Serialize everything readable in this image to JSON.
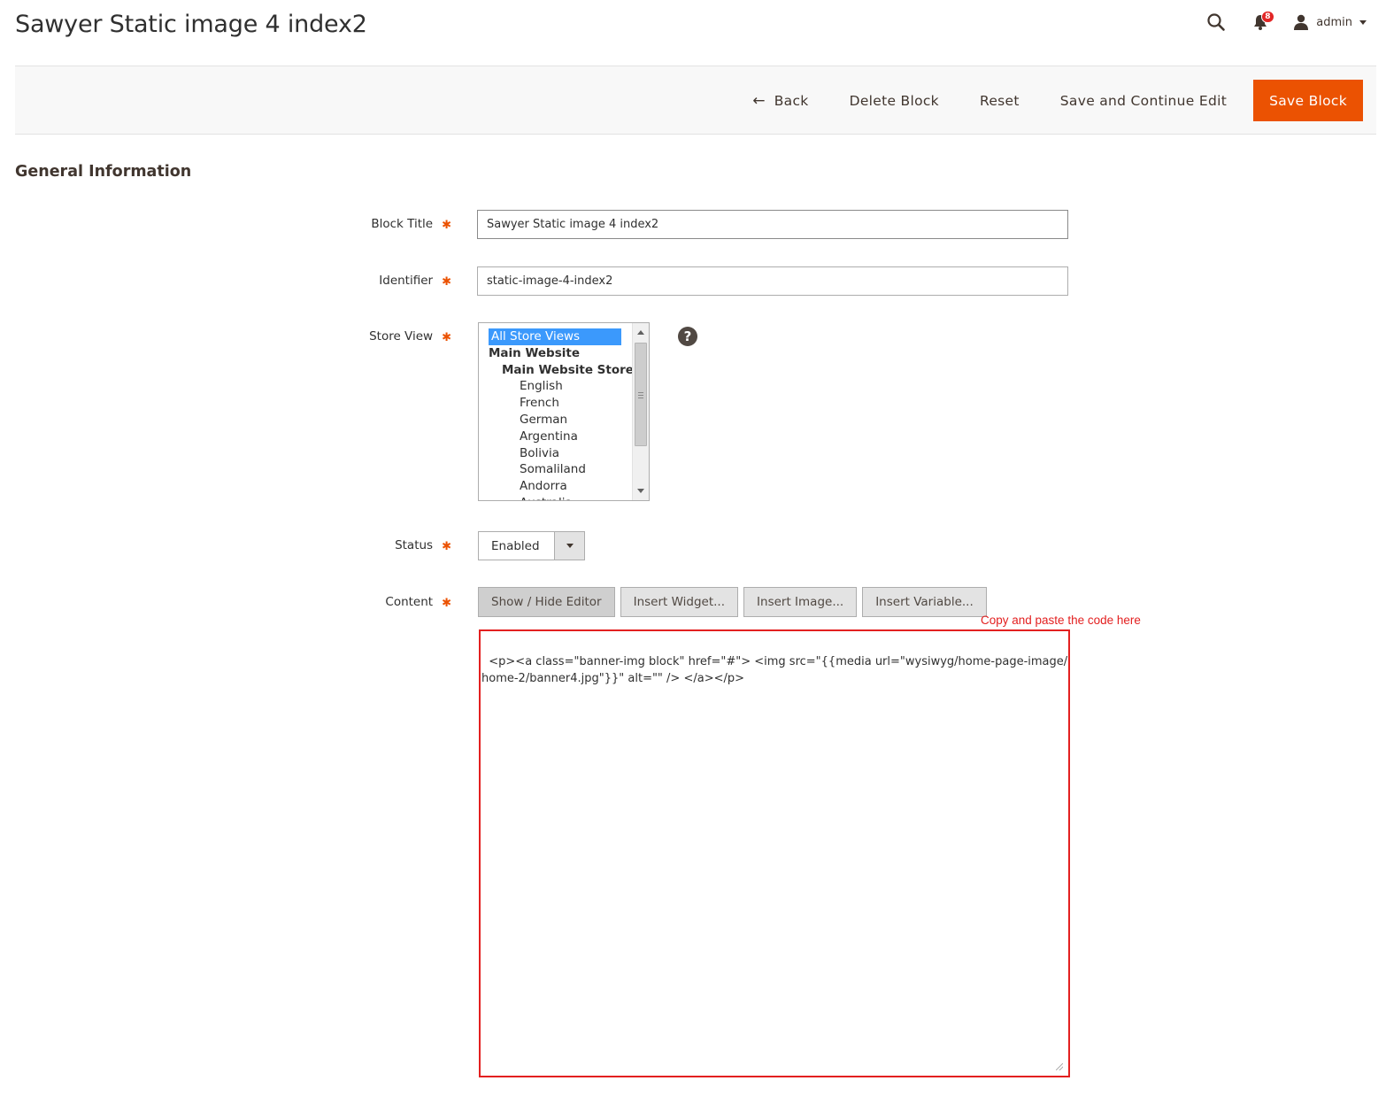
{
  "page": {
    "title": "Sawyer Static image 4 index2"
  },
  "header": {
    "search_icon": "search-icon",
    "notifications": {
      "icon": "bell-icon",
      "count": "8"
    },
    "user": {
      "icon": "user-icon",
      "name": "admin"
    }
  },
  "toolbar": {
    "back_label": "Back",
    "back_icon": "←",
    "delete_label": "Delete Block",
    "reset_label": "Reset",
    "save_continue_label": "Save and Continue Edit",
    "save_label": "Save Block"
  },
  "section": {
    "title": "General Information"
  },
  "form": {
    "block_title": {
      "label": "Block Title",
      "value": "Sawyer Static image 4 index2"
    },
    "identifier": {
      "label": "Identifier",
      "value": "static-image-4-index2"
    },
    "store_view": {
      "label": "Store View",
      "options": [
        {
          "label": "All Store Views",
          "level": "selected"
        },
        {
          "label": "Main Website",
          "level": "l0"
        },
        {
          "label": "Main Website Store",
          "level": "l1"
        },
        {
          "label": "English",
          "level": "l2"
        },
        {
          "label": "French",
          "level": "l2"
        },
        {
          "label": "German",
          "level": "l2"
        },
        {
          "label": "Argentina",
          "level": "l2"
        },
        {
          "label": "Bolivia",
          "level": "l2"
        },
        {
          "label": "Somaliland",
          "level": "l2"
        },
        {
          "label": "Andorra",
          "level": "l2"
        },
        {
          "label": "Australia",
          "level": "l2"
        }
      ],
      "help_label": "?"
    },
    "status": {
      "label": "Status",
      "value": "Enabled"
    },
    "content": {
      "label": "Content",
      "buttons": {
        "show_hide": "Show / Hide Editor",
        "insert_widget": "Insert Widget...",
        "insert_image": "Insert Image...",
        "insert_variable": "Insert Variable..."
      },
      "annotation": "Copy and paste the code here",
      "code": "<p><a class=\"banner-img block\" href=\"#\"> <img src=\"{{media url=\"wysiwyg/home-page-image/home-2/banner4.jpg\"}}\" alt=\"\" /> </a></p>"
    }
  },
  "colors": {
    "accent": "#eb5202",
    "annotation": "#e32020",
    "selection": "#3b99fc"
  }
}
